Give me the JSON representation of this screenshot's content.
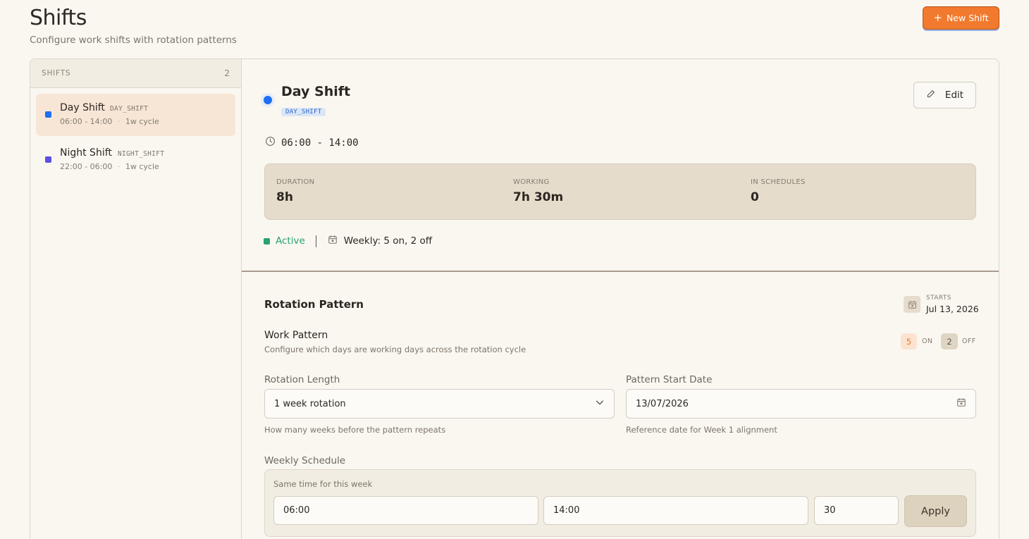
{
  "header": {
    "title": "Shifts",
    "subtitle": "Configure work shifts with rotation patterns",
    "new_shift_label": "New Shift"
  },
  "sidebar": {
    "header_label": "SHIFTS",
    "count": "2",
    "items": [
      {
        "name": "Day Shift",
        "code": "DAY_SHIFT",
        "time": "06:00 - 14:00",
        "cycle": "1w cycle",
        "color": "#1f6ff0",
        "selected": true
      },
      {
        "name": "Night Shift",
        "code": "NIGHT_SHIFT",
        "time": "22:00 - 06:00",
        "cycle": "1w cycle",
        "color": "#5a4fe0",
        "selected": false
      }
    ]
  },
  "detail": {
    "name": "Day Shift",
    "code": "DAY_SHIFT",
    "color": "#1f6ff0",
    "edit_label": "Edit",
    "time_range": "06:00 - 14:00",
    "stats": {
      "duration_label": "DURATION",
      "duration_value": "8h",
      "working_label": "WORKING",
      "working_value": "7h 30m",
      "schedules_label": "IN SCHEDULES",
      "schedules_value": "0"
    },
    "status": "Active",
    "pattern_summary": "Weekly: 5 on, 2 off"
  },
  "rotation": {
    "title": "Rotation Pattern",
    "starts_label": "STARTS",
    "starts_value": "Jul 13, 2026",
    "work_pattern_title": "Work Pattern",
    "work_pattern_desc": "Configure which days are working days across the rotation cycle",
    "on_count": "5",
    "on_label": "ON",
    "off_count": "2",
    "off_label": "OFF",
    "rotation_length_label": "Rotation Length",
    "rotation_length_value": "1 week rotation",
    "rotation_length_help": "How many weeks before the pattern repeats",
    "start_date_label": "Pattern Start Date",
    "start_date_value": "13/07/2026",
    "start_date_help": "Reference date for Week 1 alignment",
    "weekly_label": "Weekly Schedule",
    "weekly_sub": "Same time for this week",
    "weekly_start": "06:00",
    "weekly_end": "14:00",
    "weekly_break": "30",
    "apply_label": "Apply"
  },
  "colors": {
    "accent": "#f27a2e",
    "active": "#27a36b",
    "blue": "#1f6ff0"
  }
}
